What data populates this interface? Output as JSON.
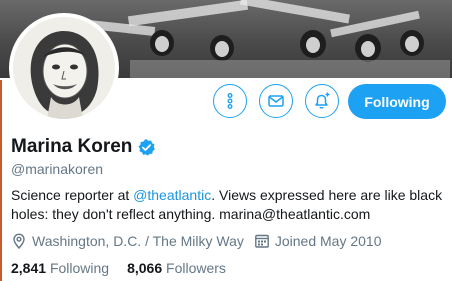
{
  "profile": {
    "name": "Marina Koren",
    "handle": "@marinakoren",
    "bio_prefix": "Science reporter at ",
    "bio_link": "@theatlantic",
    "bio_suffix": ". Views expressed here are like black holes: they don't reflect anything. marina@theatlantic.com",
    "location": "Washington, D.C. / The Milky Way",
    "joined": "Joined May 2010",
    "verified": true
  },
  "actions": {
    "follow_label": "Following",
    "more_icon": "more-vertical-icon",
    "message_icon": "envelope-icon",
    "notify_icon": "bell-plus-icon"
  },
  "stats": {
    "following_count": "2,841",
    "following_label": "Following",
    "followers_count": "8,066",
    "followers_label": "Followers"
  },
  "colors": {
    "accent": "#1da1f2",
    "link": "#1b95e0",
    "muted": "#657786",
    "text": "#14171a"
  }
}
